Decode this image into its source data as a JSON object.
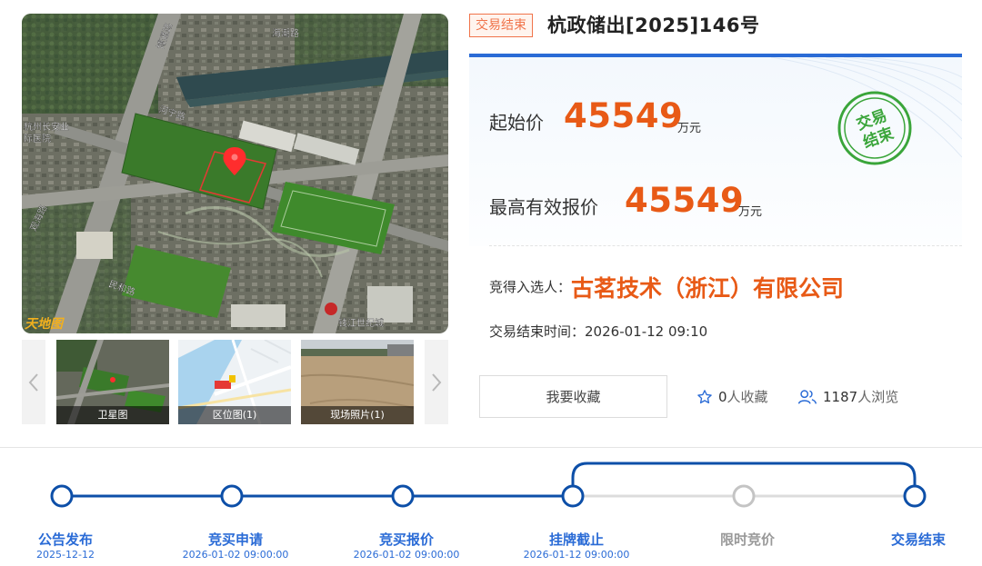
{
  "listing": {
    "status_tag": "交易结束",
    "title": "杭政储出[2025]146号",
    "start_price_label": "起始价",
    "start_price": "45549",
    "start_price_unit": "万元",
    "highest_bid_label": "最高有效报价",
    "highest_bid": "45549",
    "highest_bid_unit": "万元",
    "stamp_line1": "交易",
    "stamp_line2": "结束",
    "winner_label": "竞得入选人：",
    "winner_name": "古茗技术（浙江）有限公司",
    "end_time_label": "交易结束时间：",
    "end_time": "2026-01-12 09:10"
  },
  "actions": {
    "favorite_button": "我要收藏",
    "favorites_count": "0",
    "favorites_suffix": "人收藏",
    "views_count": "1187",
    "views_suffix": "人浏览"
  },
  "map": {
    "road_labels": [
      "博通路",
      "海潮路",
      "河宁路",
      "民和路",
      "观海路"
    ],
    "landmark_labels": [
      "杭州长安业",
      "际医院",
      "钱江世纪城"
    ],
    "watermark": "天地图"
  },
  "thumbnails": [
    {
      "caption": "卫星图",
      "icon": "satellite-thumb"
    },
    {
      "caption": "区位图(1)",
      "icon": "location-map-thumb"
    },
    {
      "caption": "现场照片(1)",
      "icon": "site-photo-thumb"
    }
  ],
  "progress": {
    "steps": [
      {
        "name": "公告发布",
        "date": "2025-12-12",
        "state": "done"
      },
      {
        "name": "竞买申请",
        "date": "2026-01-02 09:00:00",
        "state": "done"
      },
      {
        "name": "竞买报价",
        "date": "2026-01-02 09:00:00",
        "state": "done"
      },
      {
        "name": "挂牌截止",
        "date": "2026-01-12 09:00:00",
        "state": "done"
      },
      {
        "name": "限时竞价",
        "date": "",
        "state": "skipped"
      },
      {
        "name": "交易结束",
        "date": "",
        "state": "done"
      }
    ]
  },
  "colors": {
    "accent_blue": "#2a6bd6",
    "track_blue": "#0d4fa8",
    "price_orange": "#e85a16",
    "stamp_green": "#3aa53a",
    "inactive_gray": "#bdbdbd"
  }
}
